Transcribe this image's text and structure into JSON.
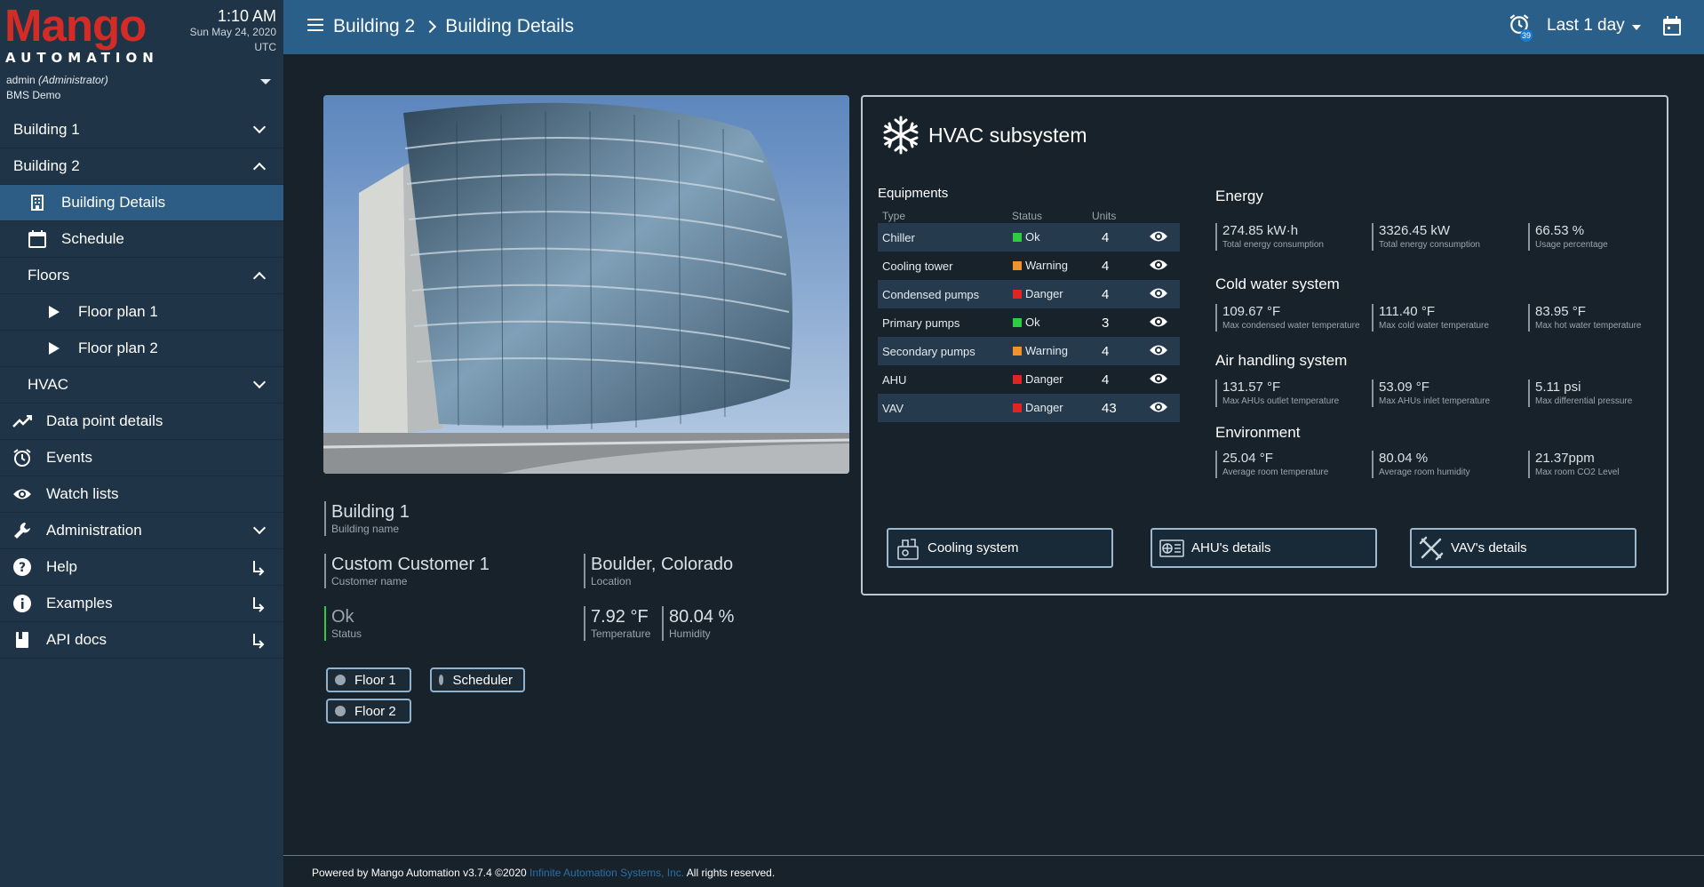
{
  "brand": {
    "name": "Mango",
    "tagline": "AUTOMATION"
  },
  "clock": {
    "time": "1:10 AM",
    "date": "Sun May 24, 2020",
    "timezone": "UTC"
  },
  "user": {
    "name": "admin",
    "role": "(Administrator)",
    "org": "BMS Demo"
  },
  "sidebar": {
    "items": [
      {
        "label": "Building 1"
      },
      {
        "label": "Building 2"
      },
      {
        "label": "Building Details"
      },
      {
        "label": "Schedule"
      },
      {
        "label": "Floors"
      },
      {
        "label": "Floor plan 1"
      },
      {
        "label": "Floor plan 2"
      },
      {
        "label": "HVAC"
      },
      {
        "label": "Data point details"
      },
      {
        "label": "Events"
      },
      {
        "label": "Watch lists"
      },
      {
        "label": "Administration"
      },
      {
        "label": "Help"
      },
      {
        "label": "Examples"
      },
      {
        "label": "API docs"
      }
    ]
  },
  "header": {
    "breadcrumb": [
      "Building 2",
      "Building Details"
    ],
    "alarm_count": "39",
    "date_range": "Last 1 day"
  },
  "building": {
    "name": {
      "value": "Building 1",
      "label": "Building name"
    },
    "customer": {
      "value": "Custom Customer 1",
      "label": "Customer name"
    },
    "location": {
      "value": "Boulder, Colorado",
      "label": "Location"
    },
    "status": {
      "value": "Ok",
      "label": "Status"
    },
    "temperature": {
      "value": "7.92 °F",
      "label": "Temperature"
    },
    "humidity": {
      "value": "80.04 %",
      "label": "Humidity"
    },
    "links": [
      "Floor 1",
      "Scheduler",
      "Floor 2"
    ]
  },
  "hvac": {
    "title": "HVAC subsystem",
    "equipment_caption": "Equipments",
    "columns": [
      "Type",
      "Status",
      "Units"
    ],
    "equipment": [
      {
        "type": "Chiller",
        "status": "Ok",
        "units": "4",
        "color": "#2ecc40"
      },
      {
        "type": "Cooling tower",
        "status": "Warning",
        "units": "4",
        "color": "#f0932b"
      },
      {
        "type": "Condensed pumps",
        "status": "Danger",
        "units": "4",
        "color": "#e02424"
      },
      {
        "type": "Primary pumps",
        "status": "Ok",
        "units": "3",
        "color": "#2ecc40"
      },
      {
        "type": "Secondary pumps",
        "status": "Warning",
        "units": "4",
        "color": "#f0932b"
      },
      {
        "type": "AHU",
        "status": "Danger",
        "units": "4",
        "color": "#e02424"
      },
      {
        "type": "VAV",
        "status": "Danger",
        "units": "43",
        "color": "#e02424"
      }
    ],
    "sections": [
      {
        "title": "Energy",
        "metrics": [
          {
            "value": "274.85 kW·h",
            "label": "Total energy consumption"
          },
          {
            "value": "3326.45 kW",
            "label": "Total energy consumption"
          },
          {
            "value": "66.53 %",
            "label": "Usage percentage"
          }
        ]
      },
      {
        "title": "Cold water system",
        "metrics": [
          {
            "value": "109.67 °F",
            "label": "Max condensed water temperature"
          },
          {
            "value": "111.40 °F",
            "label": "Max cold water temperature"
          },
          {
            "value": "83.95 °F",
            "label": "Max hot water temperature"
          }
        ]
      },
      {
        "title": "Air handling system",
        "metrics": [
          {
            "value": "131.57 °F",
            "label": "Max AHUs outlet temperature"
          },
          {
            "value": "53.09 °F",
            "label": "Max AHUs inlet temperature"
          },
          {
            "value": "5.11 psi",
            "label": "Max differential pressure"
          }
        ]
      },
      {
        "title": "Environment",
        "metrics": [
          {
            "value": "25.04 °F",
            "label": "Average room temperature"
          },
          {
            "value": "80.04 %",
            "label": "Average room humidity"
          },
          {
            "value": "21.37ppm",
            "label": "Max room CO2 Level"
          }
        ]
      }
    ],
    "buttons": [
      "Cooling system",
      "AHU's details",
      "VAV's details"
    ]
  },
  "footer": {
    "prefix": "Powered by Mango Automation v3.7.4 ©2020",
    "link": "Infinite Automation Systems, Inc.",
    "suffix": "All rights reserved."
  },
  "colors": {
    "header": "#2a5f8a",
    "sidebar": "#1f3447",
    "active": "#2d5c85",
    "brand": "#d32b26"
  }
}
